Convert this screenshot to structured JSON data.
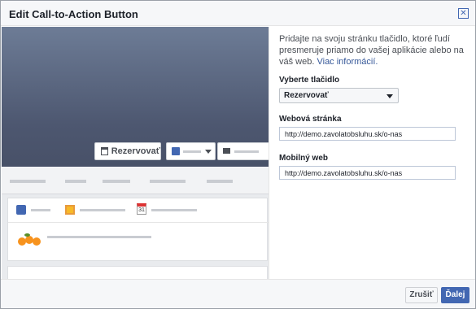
{
  "dialog": {
    "title": "Edit Call-to-Action Button",
    "close_icon": "close-icon"
  },
  "preview": {
    "cta_label": "Rezervovať",
    "cta_icon": "calendar-icon",
    "like_icon": "thumbs-up-icon",
    "message_icon": "message-icon",
    "composer_day": "31"
  },
  "panel": {
    "description": "Pridajte na svoju stránku tlačidlo, ktoré ľudí presmeruje priamo do vašej aplikácie alebo na váš web.",
    "more_info_link": "Viac informácií.",
    "select_button_label": "Vyberte tlačidlo",
    "selected_button": "Rezervovať",
    "website_label": "Webová stránka",
    "website_value": "http://demo.zavolatobsluhu.sk/o-nas",
    "mobile_label": "Mobilný web",
    "mobile_value": "http://demo.zavolatobsluhu.sk/o-nas"
  },
  "footer": {
    "cancel_label": "Zrušiť",
    "next_label": "Ďalej"
  },
  "colors": {
    "accent": "#4267b2",
    "link": "#365899"
  }
}
